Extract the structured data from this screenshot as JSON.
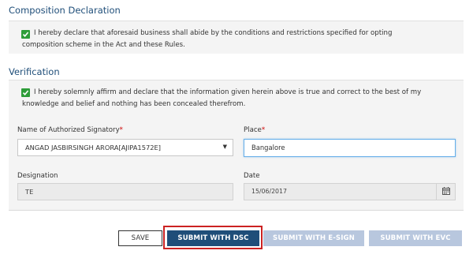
{
  "composition": {
    "title": "Composition Declaration",
    "checked": true,
    "declaration_line1": "I hereby declare that aforesaid business shall abide by the conditions and restrictions specified for opting",
    "declaration_line2": "composition scheme in the Act and these Rules."
  },
  "verification": {
    "title": "Verification",
    "checked": true,
    "declaration_line1": "I hereby solemnly affirm and declare that the information given herein above is true and correct to the best of my",
    "declaration_line2": "knowledge and belief and nothing has been concealed therefrom.",
    "signatory_label": "Name of Authorized Signatory",
    "signatory_value": "ANGAD JASBIRSINGH ARORA[AJIPA1572E]",
    "place_label": "Place",
    "place_value": "Bangalore",
    "required_mark": "*",
    "designation_label": "Designation",
    "designation_value": "TE",
    "date_label": "Date",
    "date_value": "15/06/2017"
  },
  "actions": {
    "save_label": "SAVE",
    "submit_dsc_label": "SUBMIT WITH DSC",
    "submit_esign_label": "SUBMIT WITH E-SIGN",
    "submit_evc_label": "SUBMIT WITH EVC"
  },
  "icons": {
    "checkbox": "checkmark-icon",
    "select_arrow": "dropdown-arrow-icon",
    "calendar": "calendar-icon"
  },
  "colors": {
    "heading": "#1f4e79",
    "checkbox": "#2e9d39",
    "primary_button": "#1f4e79",
    "disabled_button": "#b8c7de",
    "highlight_outline": "#cc2222",
    "required": "#cc0000"
  }
}
